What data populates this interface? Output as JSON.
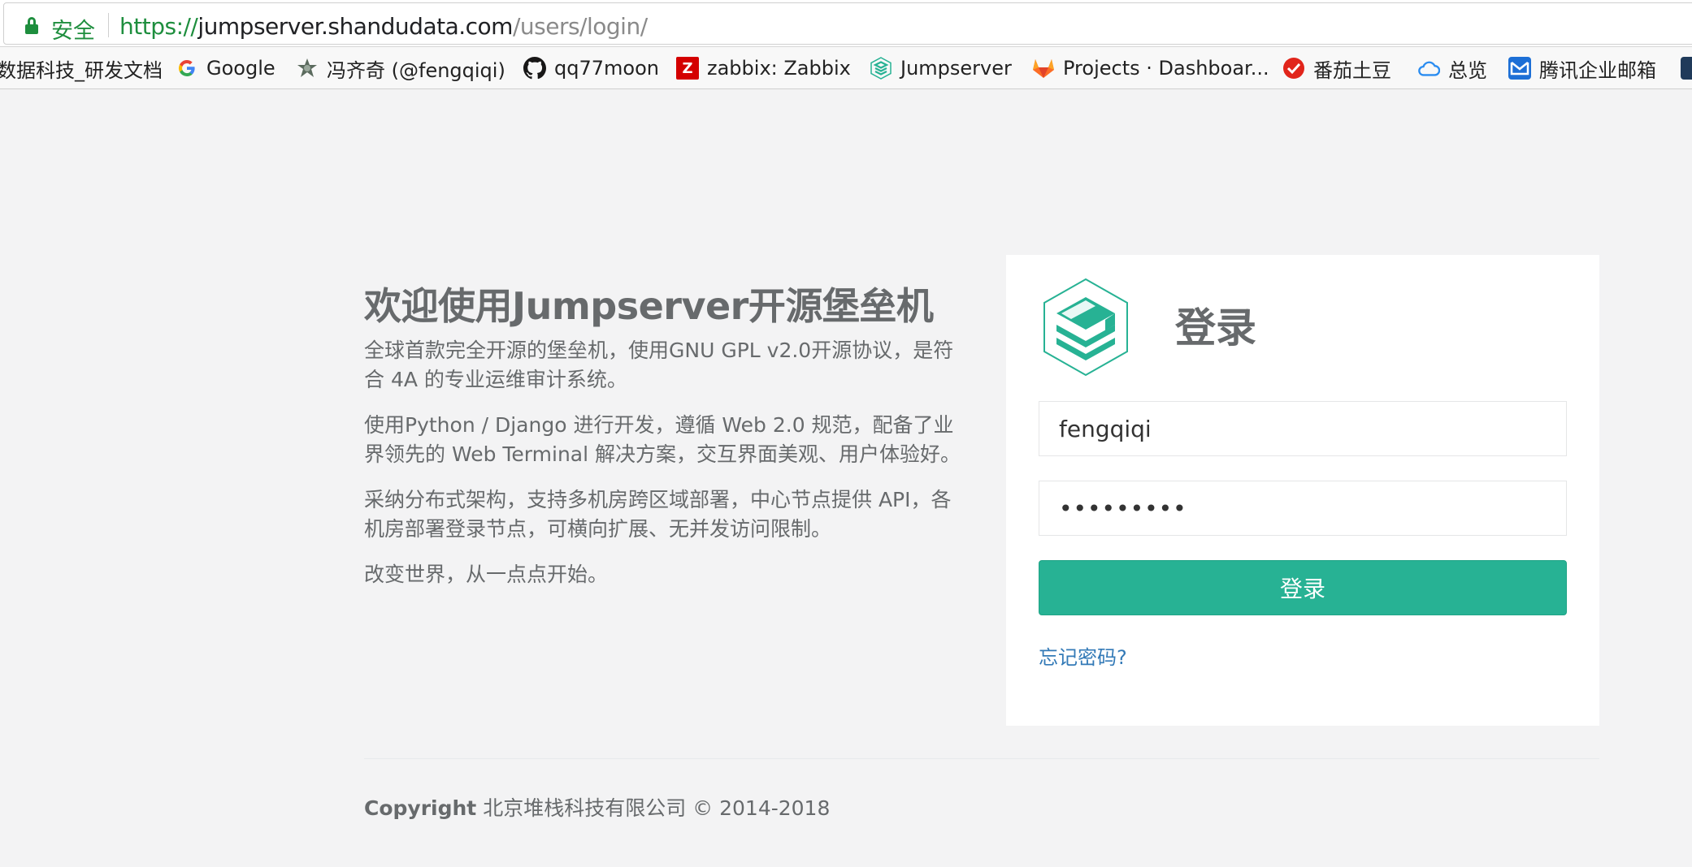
{
  "browser": {
    "secure_label": "安全",
    "url_scheme": "https://",
    "url_host": "jumpserver.shandudata.com",
    "url_path": "/users/login/"
  },
  "bookmarks": [
    {
      "label": "数据科技_研发文档",
      "icon": "none"
    },
    {
      "label": "Google",
      "icon": "google-icon"
    },
    {
      "label": "冯齐奇 (@fengqiqi)",
      "icon": "avatar-icon"
    },
    {
      "label": "qq77moon",
      "icon": "github-icon"
    },
    {
      "label": "zabbix: Zabbix",
      "icon": "zabbix-icon"
    },
    {
      "label": "Jumpserver",
      "icon": "jumpserver-icon"
    },
    {
      "label": "Projects · Dashboar...",
      "icon": "gitlab-icon"
    },
    {
      "label": "番茄土豆",
      "icon": "tomato-icon"
    },
    {
      "label": "总览",
      "icon": "cloud-icon"
    },
    {
      "label": "腾讯企业邮箱",
      "icon": "mail-icon"
    }
  ],
  "intro": {
    "title": "欢迎使用Jumpserver开源堡垒机",
    "p1": "全球首款完全开源的堡垒机，使用GNU GPL v2.0开源协议，是符合 4A 的专业运维审计系统。",
    "p2": "使用Python / Django 进行开发，遵循 Web 2.0 规范，配备了业界领先的 Web Terminal 解决方案，交互界面美观、用户体验好。",
    "p3": "采纳分布式架构，支持多机房跨区域部署，中心节点提供 API，各机房部署登录节点，可横向扩展、无并发访问限制。",
    "p4": "改变世界，从一点点开始。"
  },
  "login": {
    "title": "登录",
    "username_value": "fengqiqi",
    "password_value": "•••••••••",
    "submit_label": "登录",
    "forgot_label": "忘记密码?"
  },
  "footer": {
    "copyright_bold": "Copyright",
    "copyright_text": " 北京堆栈科技有限公司 © 2014-2018"
  },
  "colors": {
    "accent": "#27b294",
    "link": "#337ab7",
    "secure": "#1e8e3e",
    "background": "#f3f3f4"
  }
}
